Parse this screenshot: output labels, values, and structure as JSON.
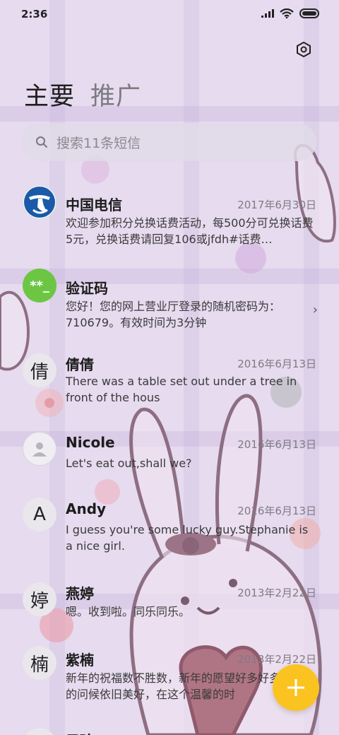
{
  "status_bar": {
    "time": "2:36"
  },
  "tabs": [
    {
      "label": "主要",
      "active": true
    },
    {
      "label": "推广",
      "active": false
    }
  ],
  "search": {
    "placeholder": "搜索11条短信"
  },
  "messages": [
    {
      "name": "中国电信",
      "date": "2017年6月30日",
      "preview": "欢迎参加积分兑换话费活动，每500分可兑换话费5元，兑换话费请回复106或jfdh#话费…",
      "avatar_type": "telecom-logo-icon"
    },
    {
      "name": "验证码",
      "date": "",
      "preview": "您好！您的网上营业厅登录的随机密码为：710679。有效时间为3分钟",
      "avatar_type": "verification-code-icon",
      "avatar_text": "**_"
    },
    {
      "name": "倩倩",
      "date": "2016年6月13日",
      "preview": "There was a table set out under a tree in front of the hous",
      "avatar_text": "倩"
    },
    {
      "name": "Nicole",
      "date": "2016年6月13日",
      "preview": "Let's eat out,shall we?",
      "avatar_type": "person-icon"
    },
    {
      "name": "Andy",
      "date": "2016年6月13日",
      "preview": "I guess you're some lucky guy.Stephanie is a nice girl.",
      "avatar_text": "A"
    },
    {
      "name": "燕婷",
      "date": "2013年2月22日",
      "preview": "嗯。收到啦。同乐同乐。",
      "avatar_text": "婷"
    },
    {
      "name": "紫楠",
      "date": "2013年2月22日",
      "preview": "新年的祝福数不胜数，新年的愿望好多好多，新年的问候依旧美好，在这个温馨的时",
      "avatar_text": "楠"
    },
    {
      "name": "子玲",
      "date": "",
      "preview": "",
      "avatar_text": ""
    }
  ],
  "colors": {
    "accent_fab": "#fbc320",
    "verification_avatar": "#6cc644",
    "telecom_blue": "#1a5aa8"
  }
}
